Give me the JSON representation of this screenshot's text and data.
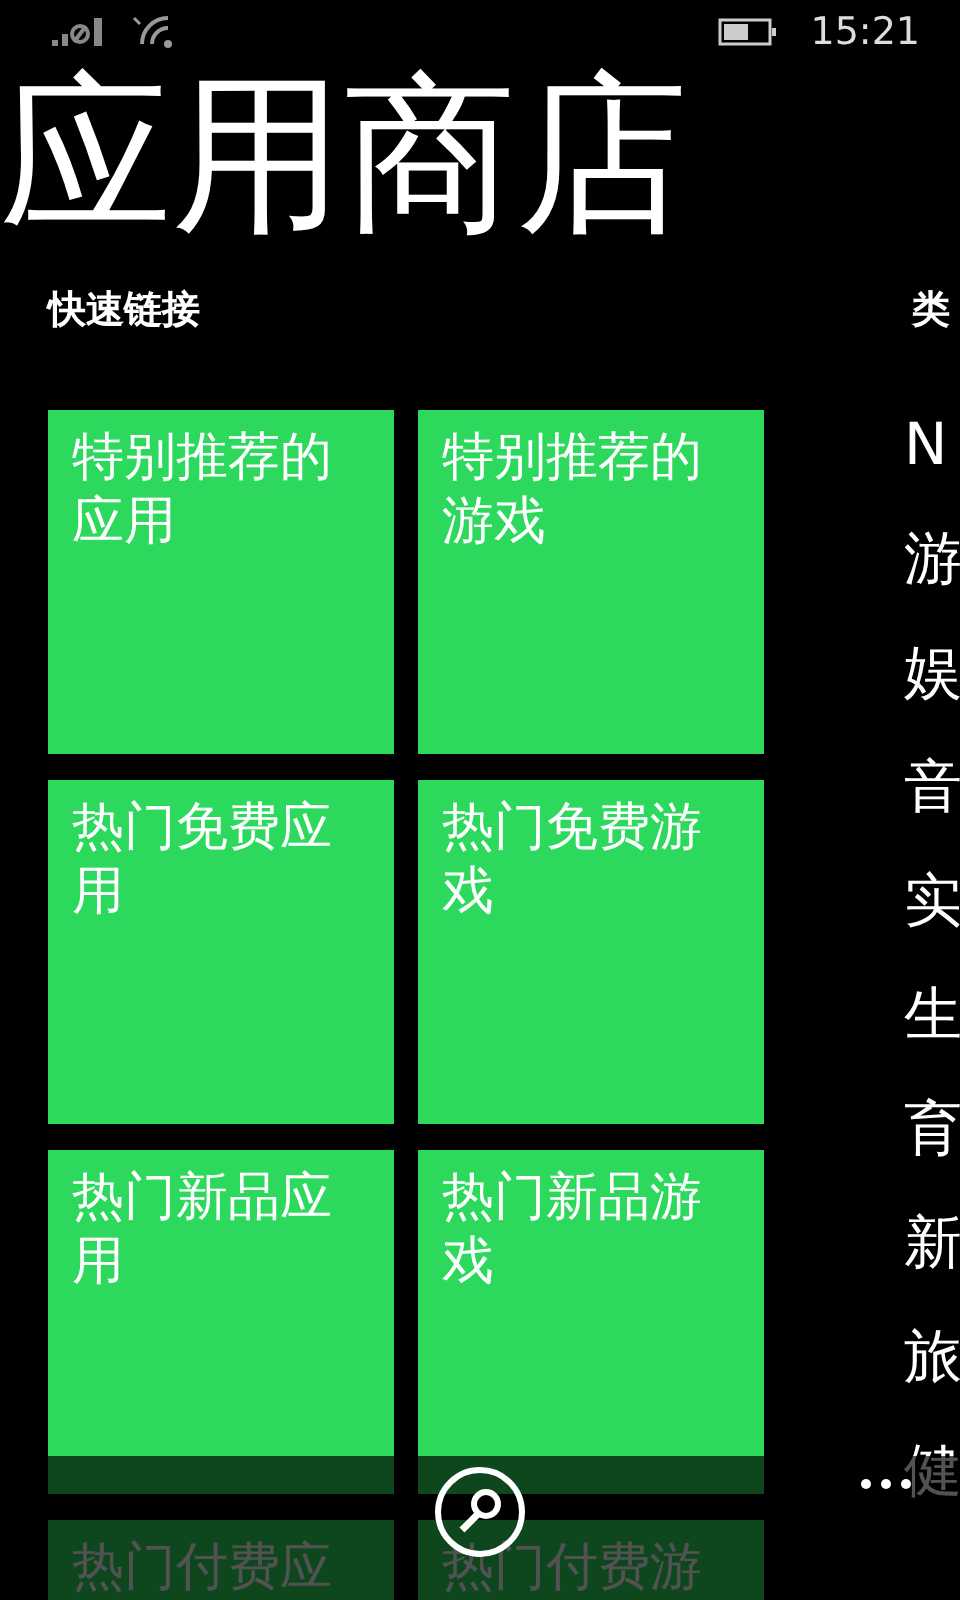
{
  "status_bar": {
    "time": "15:21"
  },
  "title": "应用商店",
  "quick_links": {
    "header": "快速链接",
    "tiles": [
      {
        "label": "特别推荐的应用"
      },
      {
        "label": "特别推荐的游戏"
      },
      {
        "label": "热门免费应用"
      },
      {
        "label": "热门免费游戏"
      },
      {
        "label": "热门新品应用"
      },
      {
        "label": "热门新品游戏"
      },
      {
        "label": "热门付费应"
      },
      {
        "label": "热门付费游"
      }
    ]
  },
  "categories": {
    "header": "类",
    "items": [
      "N",
      "游",
      "娱",
      "音",
      "实",
      "生",
      "育",
      "新",
      "旅",
      "健"
    ]
  }
}
